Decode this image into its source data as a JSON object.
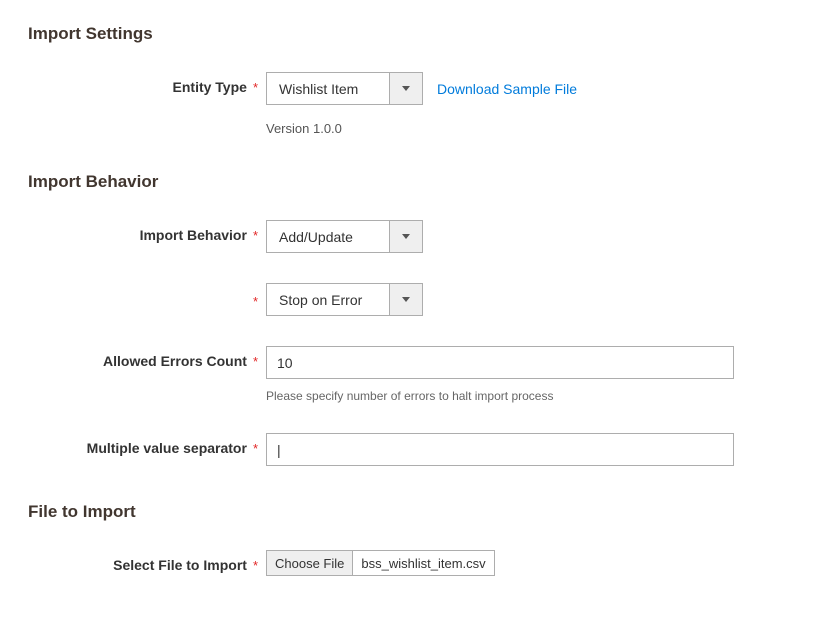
{
  "import_settings": {
    "title": "Import Settings",
    "entity_type_label": "Entity Type",
    "entity_type_value": "Wishlist Item",
    "download_link": "Download Sample File",
    "version_note": "Version 1.0.0"
  },
  "import_behavior": {
    "title": "Import Behavior",
    "behavior_label": "Import Behavior",
    "behavior_value": "Add/Update",
    "validation_value": "Stop on Error",
    "allowed_errors_label": "Allowed Errors Count",
    "allowed_errors_value": "10",
    "allowed_errors_note": "Please specify number of errors to halt import process",
    "separator_label": "Multiple value separator",
    "separator_value": "|"
  },
  "file_to_import": {
    "title": "File to Import",
    "select_file_label": "Select File to Import",
    "choose_file_btn": "Choose File",
    "file_name": "bss_wishlist_item.csv"
  },
  "required_mark": "*"
}
